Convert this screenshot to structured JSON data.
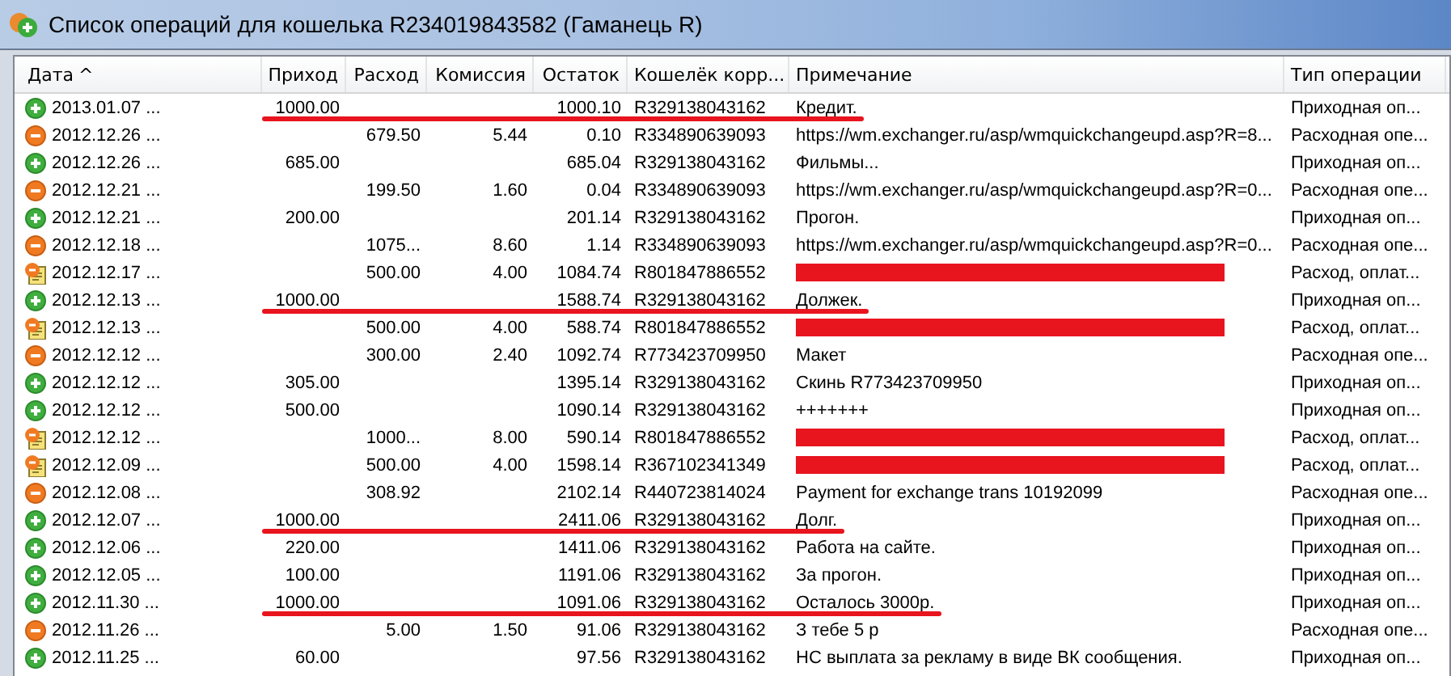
{
  "window": {
    "title": "Список операций для кошелька R234019843582 (Гаманець R)"
  },
  "table": {
    "columns": [
      {
        "label": "Дата",
        "sort": "^"
      },
      {
        "label": "Приход"
      },
      {
        "label": "Расход"
      },
      {
        "label": "Комиссия"
      },
      {
        "label": "Остаток"
      },
      {
        "label": "Кошелёк корр..."
      },
      {
        "label": "Примечание"
      },
      {
        "label": "Тип операции"
      }
    ],
    "rows": [
      {
        "kind": "income",
        "date": "2013.01.07 ...",
        "income": "1000.00",
        "expense": "",
        "fee": "",
        "balance": "1000.10",
        "wallet": "R329138043162",
        "note": "Кредит.",
        "type": "Приходная оп...",
        "underlined": true,
        "redacted": false
      },
      {
        "kind": "expense",
        "date": "2012.12.26 ...",
        "income": "",
        "expense": "679.50",
        "fee": "5.44",
        "balance": "0.10",
        "wallet": "R334890639093",
        "note": "https://wm.exchanger.ru/asp/wmquickchangeupd.asp?R=8...",
        "type": "Расходная опе...",
        "underlined": false,
        "redacted": false
      },
      {
        "kind": "income",
        "date": "2012.12.26 ...",
        "income": "685.00",
        "expense": "",
        "fee": "",
        "balance": "685.04",
        "wallet": "R329138043162",
        "note": "Фильмы...",
        "type": "Приходная оп...",
        "underlined": false,
        "redacted": false
      },
      {
        "kind": "expense",
        "date": "2012.12.21 ...",
        "income": "",
        "expense": "199.50",
        "fee": "1.60",
        "balance": "0.04",
        "wallet": "R334890639093",
        "note": "https://wm.exchanger.ru/asp/wmquickchangeupd.asp?R=0...",
        "type": "Расходная опе...",
        "underlined": false,
        "redacted": false
      },
      {
        "kind": "income",
        "date": "2012.12.21 ...",
        "income": "200.00",
        "expense": "",
        "fee": "",
        "balance": "201.14",
        "wallet": "R329138043162",
        "note": "Прогон.",
        "type": "Приходная оп...",
        "underlined": false,
        "redacted": false
      },
      {
        "kind": "expense",
        "date": "2012.12.18 ...",
        "income": "",
        "expense": "1075...",
        "fee": "8.60",
        "balance": "1.14",
        "wallet": "R334890639093",
        "note": "https://wm.exchanger.ru/asp/wmquickchangeupd.asp?R=0...",
        "type": "Расходная опе...",
        "underlined": false,
        "redacted": false
      },
      {
        "kind": "invoice",
        "date": "2012.12.17 ...",
        "income": "",
        "expense": "500.00",
        "fee": "4.00",
        "balance": "1084.74",
        "wallet": "R801847886552",
        "note": "",
        "type": "Расход, оплат...",
        "underlined": false,
        "redacted": true
      },
      {
        "kind": "income",
        "date": "2012.12.13 ...",
        "income": "1000.00",
        "expense": "",
        "fee": "",
        "balance": "1588.74",
        "wallet": "R329138043162",
        "note": "Должек.",
        "type": "Приходная оп...",
        "underlined": true,
        "redacted": false
      },
      {
        "kind": "invoice",
        "date": "2012.12.13 ...",
        "income": "",
        "expense": "500.00",
        "fee": "4.00",
        "balance": "588.74",
        "wallet": "R801847886552",
        "note": "",
        "type": "Расход, оплат...",
        "underlined": false,
        "redacted": true
      },
      {
        "kind": "expense",
        "date": "2012.12.12 ...",
        "income": "",
        "expense": "300.00",
        "fee": "2.40",
        "balance": "1092.74",
        "wallet": "R773423709950",
        "note": "Макет",
        "type": "Расходная опе...",
        "underlined": false,
        "redacted": false
      },
      {
        "kind": "income",
        "date": "2012.12.12 ...",
        "income": "305.00",
        "expense": "",
        "fee": "",
        "balance": "1395.14",
        "wallet": "R329138043162",
        "note": "Скинь R773423709950",
        "type": "Приходная оп...",
        "underlined": false,
        "redacted": false
      },
      {
        "kind": "income",
        "date": "2012.12.12 ...",
        "income": "500.00",
        "expense": "",
        "fee": "",
        "balance": "1090.14",
        "wallet": "R329138043162",
        "note": "+++++++",
        "type": "Приходная оп...",
        "underlined": false,
        "redacted": false
      },
      {
        "kind": "invoice",
        "date": "2012.12.12 ...",
        "income": "",
        "expense": "1000...",
        "fee": "8.00",
        "balance": "590.14",
        "wallet": "R801847886552",
        "note": "",
        "type": "Расход, оплат...",
        "underlined": false,
        "redacted": true
      },
      {
        "kind": "invoice",
        "date": "2012.12.09 ...",
        "income": "",
        "expense": "500.00",
        "fee": "4.00",
        "balance": "1598.14",
        "wallet": "R367102341349",
        "note": "",
        "type": "Расход, оплат...",
        "underlined": false,
        "redacted": true
      },
      {
        "kind": "expense",
        "date": "2012.12.08 ...",
        "income": "",
        "expense": "308.92",
        "fee": "",
        "balance": "2102.14",
        "wallet": "R440723814024",
        "note": "Payment for exchange trans 10192099",
        "type": "Расходная опе...",
        "underlined": false,
        "redacted": false
      },
      {
        "kind": "income",
        "date": "2012.12.07 ...",
        "income": "1000.00",
        "expense": "",
        "fee": "",
        "balance": "2411.06",
        "wallet": "R329138043162",
        "note": "Долг.",
        "type": "Приходная оп...",
        "underlined": true,
        "redacted": false
      },
      {
        "kind": "income",
        "date": "2012.12.06 ...",
        "income": "220.00",
        "expense": "",
        "fee": "",
        "balance": "1411.06",
        "wallet": "R329138043162",
        "note": "Работа на сайте.",
        "type": "Приходная оп...",
        "underlined": false,
        "redacted": false
      },
      {
        "kind": "income",
        "date": "2012.12.05 ...",
        "income": "100.00",
        "expense": "",
        "fee": "",
        "balance": "1191.06",
        "wallet": "R329138043162",
        "note": "За прогон.",
        "type": "Приходная оп...",
        "underlined": false,
        "redacted": false
      },
      {
        "kind": "income",
        "date": "2012.11.30 ...",
        "income": "1000.00",
        "expense": "",
        "fee": "",
        "balance": "1091.06",
        "wallet": "R329138043162",
        "note": "Осталось 3000р.",
        "type": "Приходная оп...",
        "underlined": true,
        "redacted": false
      },
      {
        "kind": "expense",
        "date": "2012.11.26 ...",
        "income": "",
        "expense": "5.00",
        "fee": "1.50",
        "balance": "91.06",
        "wallet": "R329138043162",
        "note": "З тебе 5 р",
        "type": "Расходная опе...",
        "underlined": false,
        "redacted": false
      },
      {
        "kind": "income",
        "date": "2012.11.25 ...",
        "income": "60.00",
        "expense": "",
        "fee": "",
        "balance": "97.56",
        "wallet": "R329138043162",
        "note": "НС выплата за рекламу в виде ВК сообщения.",
        "type": "Приходная оп...",
        "underlined": false,
        "redacted": false
      }
    ]
  }
}
